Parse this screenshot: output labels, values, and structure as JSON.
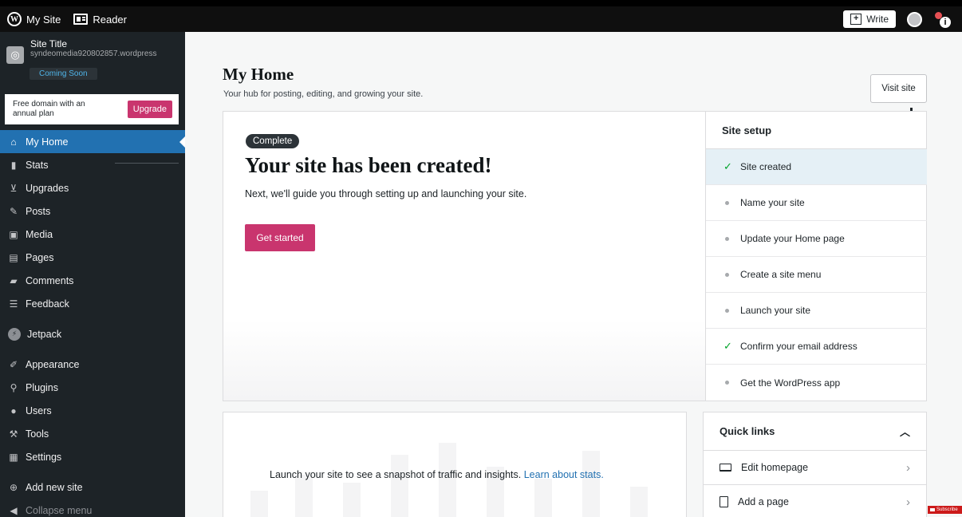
{
  "topbar": {
    "my_site": "My Site",
    "reader": "Reader",
    "write": "Write"
  },
  "sidebar": {
    "site_title": "Site Title",
    "site_url": "syndeomedia920802857.wordpress",
    "coming_soon": "Coming Soon",
    "upgrade_text_line1": "Free domain with an",
    "upgrade_text_line2": "annual plan",
    "upgrade_button": "Upgrade",
    "items": [
      {
        "label": "My Home",
        "icon": "home-icon"
      },
      {
        "label": "Stats",
        "icon": "stats-icon"
      },
      {
        "label": "Upgrades",
        "icon": "cart-icon"
      },
      {
        "label": "Posts",
        "icon": "pin-icon"
      },
      {
        "label": "Media",
        "icon": "media-icon"
      },
      {
        "label": "Pages",
        "icon": "pages-icon"
      },
      {
        "label": "Comments",
        "icon": "comment-icon"
      },
      {
        "label": "Feedback",
        "icon": "feedback-icon"
      },
      {
        "label": "Jetpack",
        "icon": "jetpack-icon"
      },
      {
        "label": "Appearance",
        "icon": "brush-icon"
      },
      {
        "label": "Plugins",
        "icon": "plug-icon"
      },
      {
        "label": "Users",
        "icon": "user-icon"
      },
      {
        "label": "Tools",
        "icon": "wrench-icon"
      },
      {
        "label": "Settings",
        "icon": "settings-icon"
      }
    ],
    "add_new_site": "Add new site",
    "collapse_menu": "Collapse menu"
  },
  "main": {
    "title": "My Home",
    "subtitle": "Your hub for posting, editing, and growing your site.",
    "visit_site": "Visit site",
    "hero": {
      "badge": "Complete",
      "heading": "Your site has been created!",
      "description": "Next, we'll guide you through setting up and launching your site.",
      "cta": "Get started"
    },
    "setup": {
      "heading": "Site setup",
      "items": [
        {
          "label": "Site created",
          "done": true
        },
        {
          "label": "Name your site",
          "done": false
        },
        {
          "label": "Update your Home page",
          "done": false
        },
        {
          "label": "Create a site menu",
          "done": false
        },
        {
          "label": "Launch your site",
          "done": false
        },
        {
          "label": "Confirm your email address",
          "done": true
        },
        {
          "label": "Get the WordPress app",
          "done": false
        }
      ]
    },
    "stats": {
      "text": "Launch your site to see a snapshot of traffic and insights.",
      "link": "Learn about stats."
    },
    "quick_links": {
      "heading": "Quick links",
      "items": [
        {
          "label": "Edit homepage",
          "icon": "laptop-icon"
        },
        {
          "label": "Add a page",
          "icon": "page-icon"
        }
      ]
    }
  },
  "overlay": {
    "subscribe": "Subscribe"
  },
  "colors": {
    "accent": "#2271b1",
    "brand_pink": "#c9356e",
    "sidebar_bg": "#1d2327",
    "success": "#00a32a"
  }
}
